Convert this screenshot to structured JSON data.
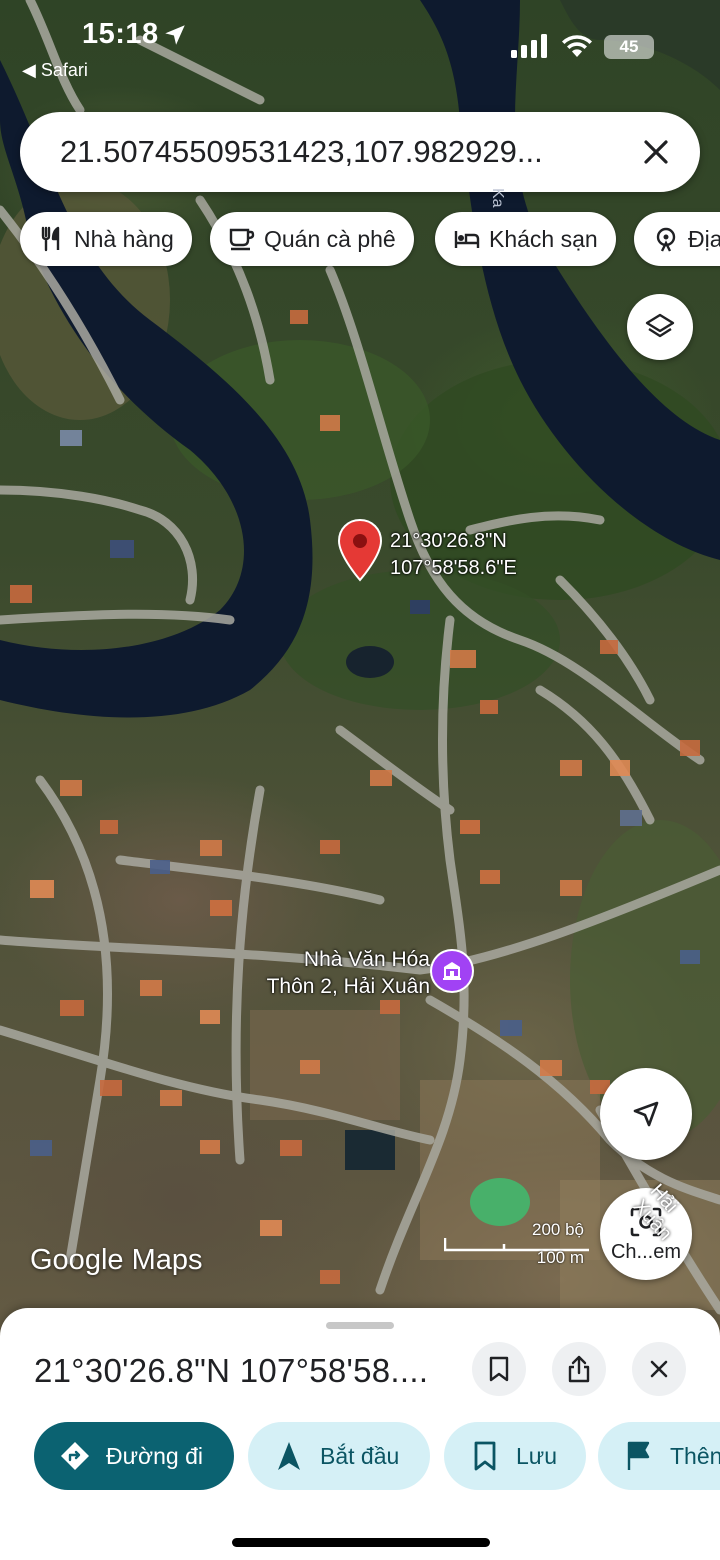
{
  "status_bar": {
    "time": "15:18",
    "back_app": "◀ Safari",
    "battery": "45"
  },
  "search": {
    "query": "21.50745509531423,107.982929..."
  },
  "chips": [
    {
      "label": "Nhà hàng",
      "icon": "restaurant-icon"
    },
    {
      "label": "Quán cà phê",
      "icon": "coffee-icon"
    },
    {
      "label": "Khách sạn",
      "icon": "hotel-icon"
    },
    {
      "label": "Địa",
      "icon": "attraction-icon"
    }
  ],
  "map": {
    "pin_lat": "21°30'26.8\"N",
    "pin_lng": "107°58'58.6\"E",
    "poi_line1": "Nhà Văn Hóa",
    "poi_line2": "Thôn 2, Hải Xuân",
    "road_label": "Hải Xuân",
    "river_label": "Ka",
    "logo": "Google Maps",
    "scale_top": "200 bộ",
    "scale_bottom": "100 m",
    "lens_label": "Ch...em"
  },
  "sheet": {
    "title": "21°30'26.8\"N 107°58'58....",
    "actions": [
      {
        "label": "Đường đi",
        "icon": "directions-icon"
      },
      {
        "label": "Bắt đầu",
        "icon": "navigation-icon"
      },
      {
        "label": "Lưu",
        "icon": "bookmark-icon"
      },
      {
        "label": "Thên",
        "icon": "flag-icon"
      }
    ]
  },
  "colors": {
    "primary": "#0b6271",
    "secondary_bg": "#d5f0f6",
    "pin": "#e53935",
    "poi": "#a142f4",
    "river": "#0e1a2e"
  }
}
